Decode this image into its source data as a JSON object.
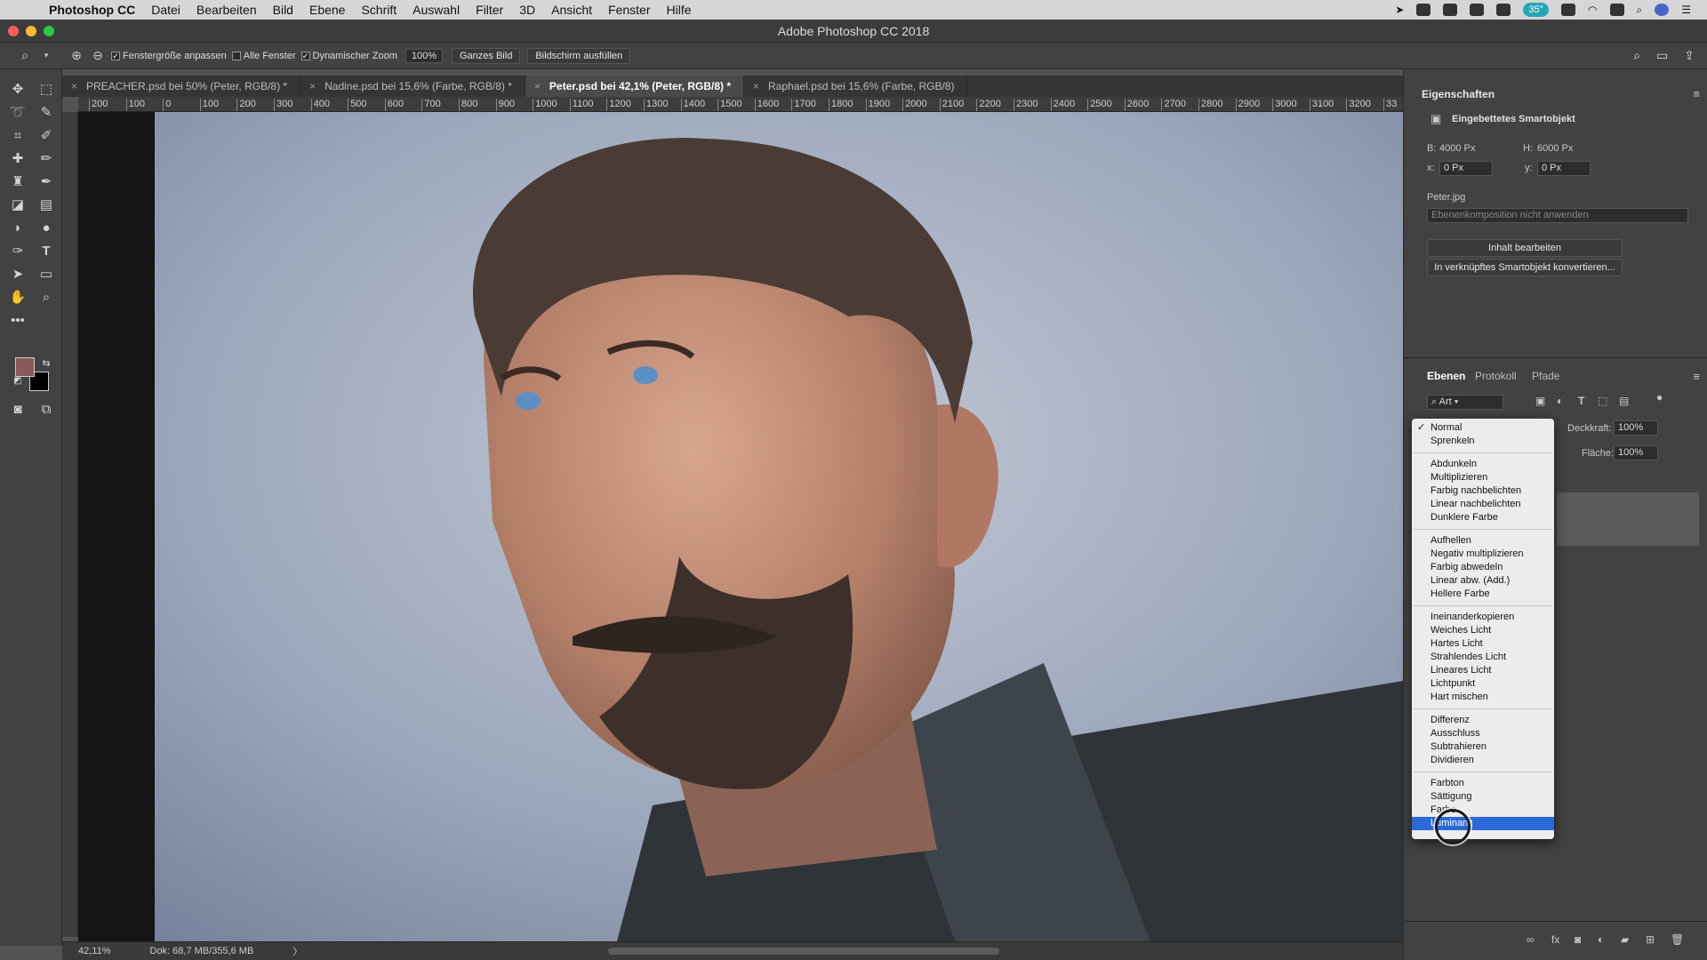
{
  "menubar": {
    "app": "Photoshop CC",
    "items": [
      "Datei",
      "Bearbeiten",
      "Bild",
      "Ebene",
      "Schrift",
      "Auswahl",
      "Filter",
      "3D",
      "Ansicht",
      "Fenster",
      "Hilfe"
    ],
    "battery": "35°"
  },
  "window": {
    "title": "Adobe Photoshop CC 2018"
  },
  "options": {
    "fit_label": "Fenstergröße anpassen",
    "all_windows_label": "Alle Fenster",
    "dynamic_zoom_label": "Dynamischer Zoom",
    "zoom_value": "100%",
    "fit_screen_label": "Ganzes Bild",
    "fill_screen_label": "Bildschirm ausfüllen"
  },
  "tabs": [
    {
      "label": "PREACHER.psd bei 50% (Peter, RGB/8) *"
    },
    {
      "label": "Nadine.psd bei 15,6% (Farbe, RGB/8) *"
    },
    {
      "label": "Peter.psd bei 42,1% (Peter, RGB/8) *"
    },
    {
      "label": "Raphael.psd bei 15,6% (Farbe, RGB/8)"
    }
  ],
  "ruler": {
    "h": [
      "200",
      "100",
      "0",
      "100",
      "200",
      "300",
      "400",
      "500",
      "600",
      "700",
      "800",
      "900",
      "1000",
      "1100",
      "1200",
      "1300",
      "1400",
      "1500",
      "1600",
      "1700",
      "1800",
      "1900",
      "2000",
      "2100",
      "2200",
      "2300",
      "2400",
      "2500",
      "2600",
      "2700",
      "2800",
      "2900",
      "3000",
      "3100",
      "3200",
      "33"
    ]
  },
  "status": {
    "zoom": "42,11%",
    "doc": "Dok: 68,7 MB/355,6 MB",
    "arrow": "〉"
  },
  "properties": {
    "title": "Eigenschaften",
    "type": "Eingebettetes Smartobjekt",
    "w_label": "B:",
    "w_value": "4000 Px",
    "h_label": "H:",
    "h_value": "6000 Px",
    "x_label": "x:",
    "x_value": "0 Px",
    "y_label": "y:",
    "y_value": "0 Px",
    "file": "Peter.jpg",
    "comp_placeholder": "Ebenenkomposition nicht anwenden",
    "edit_button": "Inhalt bearbeiten",
    "convert_button": "In verknüpftes Smartobjekt konvertieren..."
  },
  "layers": {
    "tabs": [
      "Ebenen",
      "Protokoll",
      "Pfade"
    ],
    "filter": "Art",
    "opacity_label": "Deckkraft:",
    "opacity": "100%",
    "fill_label": "Fläche:",
    "fill": "100%"
  },
  "blend_modes": {
    "groups": [
      [
        "Normal",
        "Sprenkeln"
      ],
      [
        "Abdunkeln",
        "Multiplizieren",
        "Farbig nachbelichten",
        "Linear nachbelichten",
        "Dunklere Farbe"
      ],
      [
        "Aufhellen",
        "Negativ multiplizieren",
        "Farbig abwedeln",
        "Linear abw. (Add.)",
        "Hellere Farbe"
      ],
      [
        "Ineinanderkopieren",
        "Weiches Licht",
        "Hartes Licht",
        "Strahlendes Licht",
        "Lineares Licht",
        "Lichtpunkt",
        "Hart mischen"
      ],
      [
        "Differenz",
        "Ausschluss",
        "Subtrahieren",
        "Dividieren"
      ],
      [
        "Farbton",
        "Sättigung",
        "Farbe",
        "Luminanz"
      ]
    ],
    "checked": "Normal",
    "highlighted": "Luminanz"
  },
  "colors": {
    "foreground": "#8a5a58",
    "background": "#000000",
    "highlight": "#2b6ad6"
  }
}
